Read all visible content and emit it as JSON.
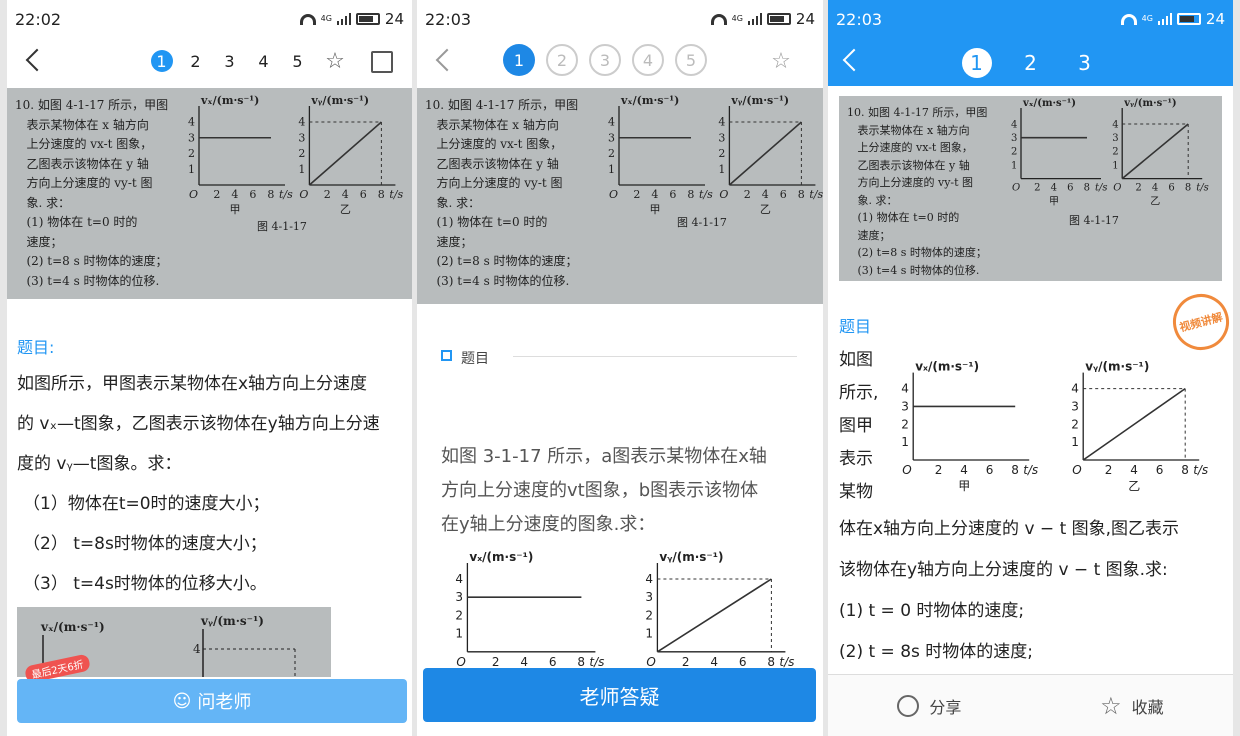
{
  "screens": [
    {
      "status_time": "22:02",
      "battery": "24",
      "pages": [
        "1",
        "2",
        "3",
        "4",
        "5"
      ],
      "photo_lines": "10. 如图 4-1-17 所示，甲图\n   表示某物体在 x 轴方向\n   上分速度的 vx-t 图象，\n   乙图表示该物体在 y 轴\n   方向上分速度的 vy-t 图\n   象. 求：\n   (1) 物体在 t=0 时的\n   速度；\n   (2) t=8 s 时物体的速度；\n   (3) t=4 s 时物体的位移.",
      "photo_caption": "图 4-1-17",
      "label": "题目:",
      "text_lines": [
        "如图所示，甲图表示某物体在x轴方向上分速度",
        "的 vₓ—t图象，乙图表示该物体在y轴方向上分速",
        "度的 vᵧ—t图象。求：",
        "（1）物体在t=0时的速度大小；",
        "（2） t=8s时物体的速度大小；",
        "（3） t=4s时物体的位移大小。"
      ],
      "promo_tag": "最后2天6折",
      "button": "问老师"
    },
    {
      "status_time": "22:03",
      "battery": "24",
      "pages": [
        "1",
        "2",
        "3",
        "4",
        "5"
      ],
      "photo_lines": "10. 如图 4-1-17 所示，甲图\n   表示某物体在 x 轴方向\n   上分速度的 vx-t 图象，\n   乙图表示该物体在 y 轴\n   方向上分速度的 vy-t 图\n   象. 求：\n   (1) 物体在 t=0 时的\n   速度；\n   (2) t=8 s 时物体的速度；\n   (3) t=4 s 时物体的位移.",
      "photo_caption": "图 4-1-17",
      "label": "题目",
      "text_lines": [
        "如图 3-1-17 所示，a图表示某物体在x轴",
        "方向上分速度的vt图象，b图表示该物体",
        "在y轴上分速度的图象.求："
      ],
      "button": "老师答疑"
    },
    {
      "status_time": "22:03",
      "battery": "24",
      "pages": [
        "1",
        "2",
        "3"
      ],
      "photo_lines": "10. 如图 4-1-17 所示，甲图\n   表示某物体在 x 轴方向\n   上分速度的 vx-t 图象，\n   乙图表示该物体在 y 轴\n   方向上分速度的 vy-t 图\n   象. 求：\n   (1) 物体在 t=0 时的\n   速度；\n   (2) t=8 s 时物体的速度；\n   (3) t=4 s 时物体的位移.",
      "photo_caption": "图 4-1-17",
      "label": "题目",
      "stamp": "视频讲解",
      "side_text": [
        "如图",
        "所示,",
        "图甲",
        "表示",
        "某物"
      ],
      "text_lines": [
        "体在x轴方向上分速度的 v − t 图象,图乙表示",
        "该物体在y轴方向上分速度的 v − t 图象.求:",
        "(1) t = 0 时物体的速度;",
        "(2) t = 8s 时物体的速度;"
      ],
      "share": "分享",
      "fav": "收藏"
    }
  ],
  "graphs": {
    "left_ylabel": "vₓ/(m·s⁻¹)",
    "right_ylabel": "vᵧ/(m·s⁻¹)",
    "xlabel": "t/s",
    "left_caption": "甲",
    "right_caption": "乙",
    "origin": "O"
  },
  "chart_data": [
    {
      "type": "line",
      "title": "",
      "xlabel": "t/s",
      "ylabel": "vx/(m·s⁻¹)",
      "x": [
        0,
        8
      ],
      "y": [
        3,
        3
      ],
      "xlim": [
        0,
        8
      ],
      "ylim": [
        0,
        4
      ]
    },
    {
      "type": "line",
      "title": "",
      "xlabel": "t/s",
      "ylabel": "vy/(m·s⁻¹)",
      "x": [
        0,
        8
      ],
      "y": [
        0,
        4
      ],
      "xlim": [
        0,
        8
      ],
      "ylim": [
        0,
        4
      ]
    }
  ]
}
